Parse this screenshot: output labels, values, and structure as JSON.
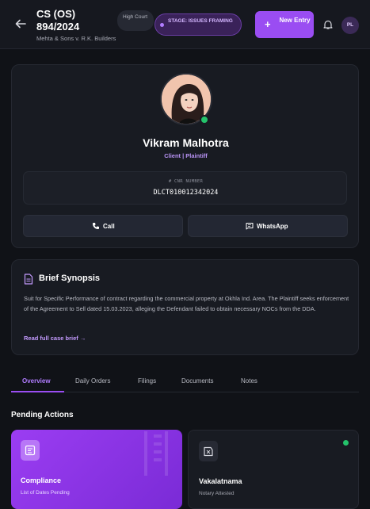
{
  "header": {
    "case_number": "CS (OS) 894/2024",
    "parties": "Mehta & Sons v. R.K. Builders",
    "court_badge": "High Court",
    "stage_badge": "STAGE: ISSUES FRAMING",
    "new_entry_label": "New Entry",
    "user_initials": "PL"
  },
  "profile": {
    "name": "Vikram Malhotra",
    "role": "Client | Plaintiff",
    "cnr_label": "CNR NUMBER",
    "cnr_value": "DLCT010012342024",
    "call_label": "Call",
    "whatsapp_label": "WhatsApp",
    "status": "online"
  },
  "synopsis": {
    "title": "Brief Synopsis",
    "text": "Suit for Specific Performance of contract regarding the commercial property at Okhla Ind. Area. The Plaintiff seeks enforcement of the Agreement to Sell dated 15.03.2023, alleging the Defendant failed to obtain necessary NOCs from the DDA.",
    "link": "Read full case brief →"
  },
  "tabs": [
    {
      "label": "Overview",
      "active": true
    },
    {
      "label": "Daily Orders",
      "active": false
    },
    {
      "label": "Filings",
      "active": false
    },
    {
      "label": "Documents",
      "active": false
    },
    {
      "label": "Notes",
      "active": false
    }
  ],
  "pending": {
    "title": "Pending Actions",
    "cards": [
      {
        "title": "Compliance",
        "subtitle": "List of Dates Pending",
        "icon": "checklist-icon"
      },
      {
        "title": "Vakalatnama",
        "subtitle": "Notary Attested",
        "icon": "stamp-icon"
      }
    ]
  },
  "colors": {
    "accent": "#9a4df2",
    "online": "#24c36b",
    "background": "#101217"
  }
}
